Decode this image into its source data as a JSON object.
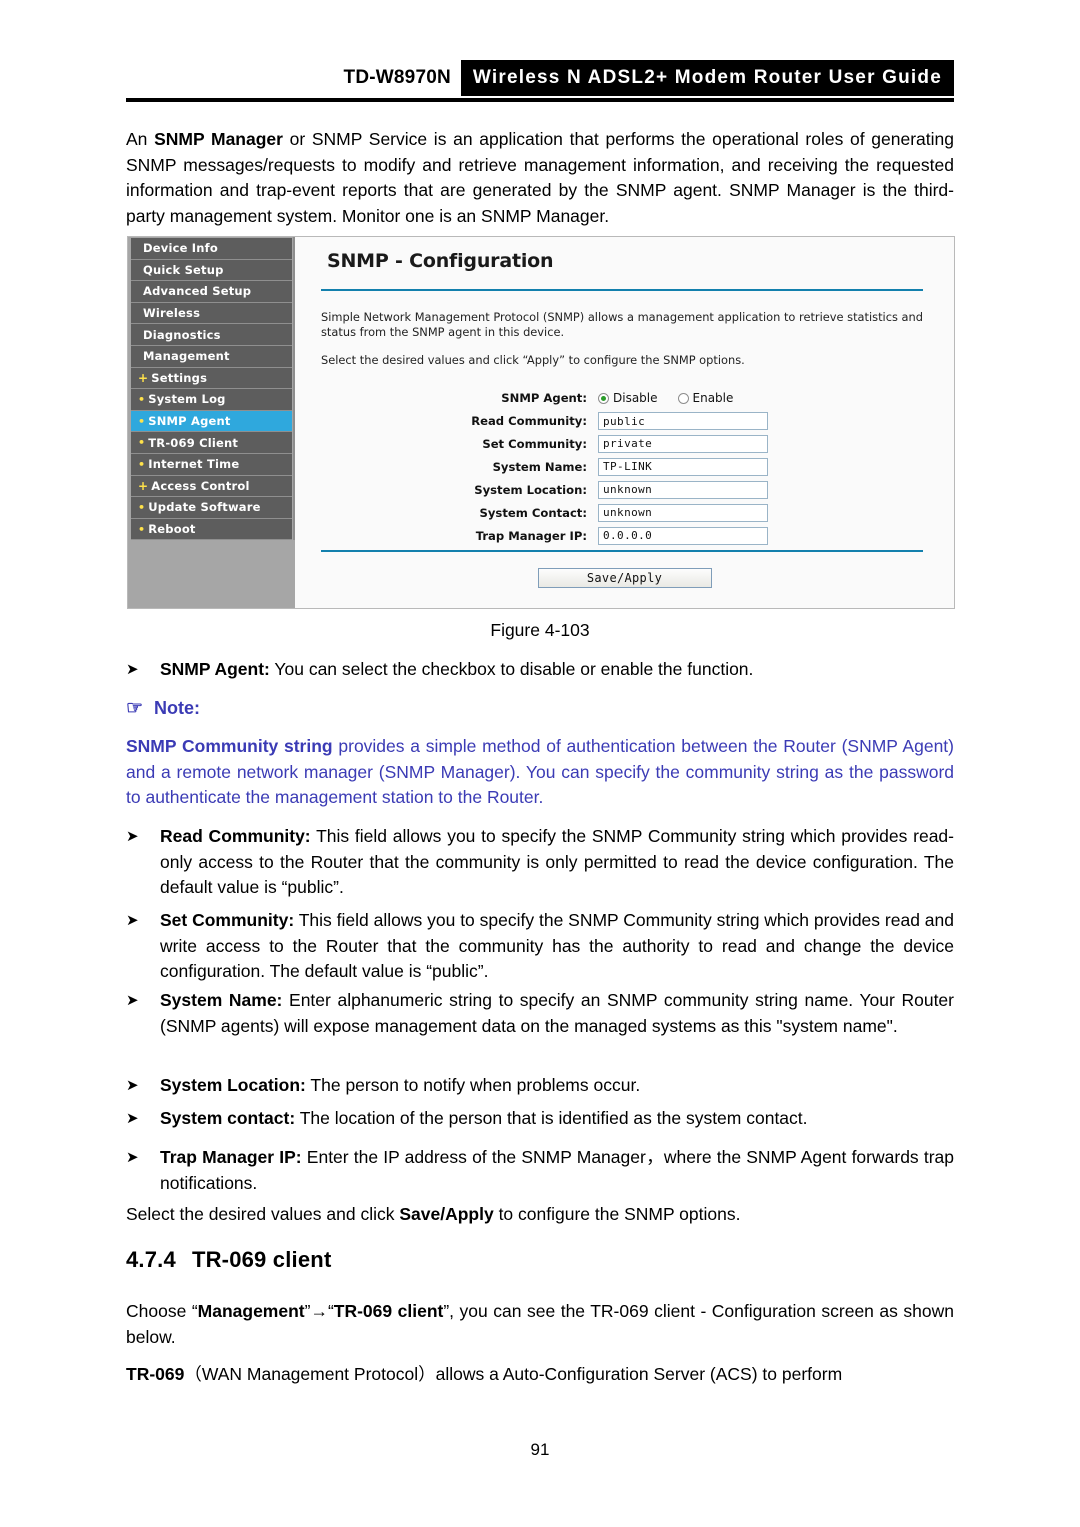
{
  "header": {
    "model": "TD-W8970N",
    "title": "Wireless N ADSL2+ Modem Router User Guide"
  },
  "intro_paragraph": {
    "lead": "An ",
    "bold": "SNMP Manager",
    "rest": " or SNMP Service is an application that performs the operational roles of generating SNMP messages/requests to modify and retrieve management information, and receiving the requested information and trap-event reports that are generated by the SNMP agent. SNMP Manager is the third-party management system. Monitor one is an SNMP Manager."
  },
  "screenshot": {
    "sidebar": {
      "items": [
        {
          "label": "Device Info",
          "level": "top",
          "icon": "",
          "selected": false
        },
        {
          "label": "Quick Setup",
          "level": "top",
          "icon": "",
          "selected": false
        },
        {
          "label": "Advanced Setup",
          "level": "top",
          "icon": "",
          "selected": false
        },
        {
          "label": "Wireless",
          "level": "top",
          "icon": "",
          "selected": false
        },
        {
          "label": "Diagnostics",
          "level": "top",
          "icon": "",
          "selected": false
        },
        {
          "label": "Management",
          "level": "top",
          "icon": "",
          "selected": false
        },
        {
          "label": "Settings",
          "level": "sub",
          "icon": "plus-bullet-icon",
          "selected": false
        },
        {
          "label": "System Log",
          "level": "sub",
          "icon": "dot-bullet-icon",
          "selected": false
        },
        {
          "label": "SNMP Agent",
          "level": "sub",
          "icon": "dot-bullet-icon",
          "selected": true
        },
        {
          "label": "TR-069 Client",
          "level": "sub",
          "icon": "dot-bullet-icon",
          "selected": false
        },
        {
          "label": "Internet Time",
          "level": "sub",
          "icon": "dot-bullet-icon",
          "selected": false
        },
        {
          "label": "Access Control",
          "level": "sub",
          "icon": "plus-bullet-icon",
          "selected": false
        },
        {
          "label": "Update Software",
          "level": "sub",
          "icon": "dot-bullet-icon",
          "selected": false
        },
        {
          "label": "Reboot",
          "level": "sub",
          "icon": "dot-bullet-icon",
          "selected": false
        }
      ]
    },
    "panel": {
      "title": "SNMP - Configuration",
      "description": "Simple Network Management Protocol (SNMP) allows a management application to retrieve statistics and status from the SNMP agent in this device.",
      "instruction": "Select the desired values and click “Apply” to configure the SNMP options.",
      "fields": [
        {
          "label": "SNMP Agent:",
          "type": "radio",
          "options": [
            "Disable",
            "Enable"
          ],
          "selected": "Disable"
        },
        {
          "label": "Read Community:",
          "type": "text",
          "value": "public"
        },
        {
          "label": "Set Community:",
          "type": "text",
          "value": "private"
        },
        {
          "label": "System Name:",
          "type": "text",
          "value": "TP-LINK"
        },
        {
          "label": "System Location:",
          "type": "text",
          "value": "unknown"
        },
        {
          "label": "System Contact:",
          "type": "text",
          "value": "unknown"
        },
        {
          "label": "Trap Manager IP:",
          "type": "text",
          "value": "0.0.0.0"
        }
      ],
      "save_button": "Save/Apply",
      "accent_color": "#1380ad",
      "selected_nav_color": "#2fa8dd"
    }
  },
  "figure_caption": "Figure 4-103",
  "bullets_top": [
    {
      "marker": "➤",
      "bold": "SNMP Agent:",
      "text": " You can select the checkbox to disable or enable the function."
    }
  ],
  "note": {
    "icon": "pointing-hand-icon",
    "glyph": "☞",
    "heading": "Note:",
    "bold": "SNMP Community string",
    "text": " provides a simple method of authentication between the Router (SNMP Agent) and a remote network manager (SNMP Manager). You can specify the community string as the password to authenticate the management station to the Router.",
    "color": "#3b3bb5"
  },
  "bullets_main": [
    {
      "marker": "➤",
      "bold": "Read Community:",
      "text": " This field allows you to specify the SNMP Community string which provides read-only access to the Router that the community is only permitted to read the device configuration. The default value is “public”."
    },
    {
      "marker": "➤",
      "bold": "Set Community:",
      "text": " This field allows you to specify the SNMP Community string which provides read and write access to the Router that the community has the authority to read and change the device configuration. The default value is “public”."
    },
    {
      "marker": "➤",
      "bold": "System Name:",
      "text": " Enter alphanumeric string to specify an SNMP community string name. Your Router (SNMP agents) will expose management data on the managed systems as this \"system name\"."
    },
    {
      "marker": "➤",
      "bold": "System Location:",
      "text": " The person to notify when problems occur."
    },
    {
      "marker": "➤",
      "bold": "System contact:",
      "text": " The location of the person that is identified as the system contact."
    },
    {
      "marker": "➤",
      "bold": "Trap Manager IP:",
      "text": " Enter the IP address of the SNMP Manager，where the SNMP Agent forwards trap notifications."
    }
  ],
  "closing_paragraph": {
    "pre": "Select the desired values and click ",
    "bold": "Save/Apply",
    "post": " to configure the SNMP options."
  },
  "section": {
    "number": "4.7.4",
    "title": "TR-069 client"
  },
  "section_paragraphs": {
    "choose_pre": "Choose “",
    "choose_b1": "Management",
    "choose_mid": "”→“",
    "choose_b2": "TR-069 client",
    "choose_post": "”, you can see the TR-069 client - Configuration screen as shown below.",
    "tr069_bold": "TR-069",
    "tr069_text": "（WAN Management Protocol）allows a Auto-Configuration Server (ACS) to perform"
  },
  "page_number": "91"
}
